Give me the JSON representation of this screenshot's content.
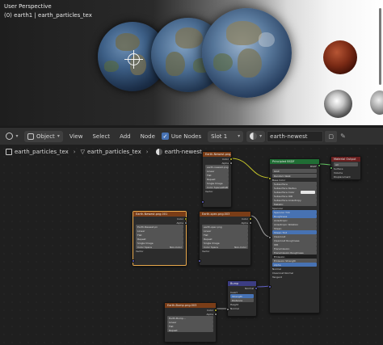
{
  "viewport": {
    "perspective_label": "User Perspective",
    "object_label": "(0) earth1 | earth_particles_tex"
  },
  "header": {
    "object_mode": "Object",
    "menus": [
      "View",
      "Select",
      "Add",
      "Node"
    ],
    "use_nodes_label": "Use Nodes",
    "use_nodes_checked": true,
    "slot": "Slot 1",
    "material": "earth-newest"
  },
  "breadcrumb": {
    "object": "earth_particles_tex",
    "mesh": "earth_particles_tex",
    "material": "earth-newest"
  },
  "nodes": {
    "img_top": {
      "title": "Earth-Newest.png.003",
      "outputs": [
        "Color",
        "Alpha"
      ],
      "file": "earth-newest.png",
      "fields": [
        "Linear",
        "Flat",
        "Repeat",
        "Single Image",
        "Color Space",
        "sRGB"
      ],
      "input": "Vector"
    },
    "img_left": {
      "title": "Earth-Newest.png.001",
      "outputs": [
        "Color",
        "Alpha"
      ],
      "file": "Earth-Newest.pn",
      "fields": [
        "Linear",
        "Flat",
        "Repeat",
        "Single Image",
        "Color Space",
        "Non-Color"
      ],
      "input": "Vector"
    },
    "img_mid": {
      "title": "Earth-spec.png.003",
      "outputs": [
        "Color",
        "Alpha"
      ],
      "file": "earth-spec.png",
      "fields": [
        "Linear",
        "Flat",
        "Repeat",
        "Single Image",
        "Color Space",
        "Non-Color"
      ],
      "input": "Vector"
    },
    "img_bottom": {
      "title": "Earth-Bump.png.003",
      "outputs": [
        "Color",
        "Alpha"
      ],
      "file": "Earth-Bump...",
      "fields": [
        "Linear",
        "Flat",
        "Repeat"
      ],
      "input": "Vector"
    },
    "bsdf": {
      "title": "Principled BSDF",
      "output": "BSDF",
      "dropdowns": [
        "GGX",
        "Random Walk"
      ],
      "rows": [
        "Base Color",
        "Subsurface",
        "Subsurface Radius",
        "Subsurface Color",
        "Subsurface IOR",
        "Subsurface Anisotropy",
        "Metallic",
        "Specular",
        "Specular Tint",
        "Roughness",
        "Anisotropic",
        "Anisotropic Rotation",
        "Sheen",
        "Sheen Tint",
        "Clearcoat",
        "Clearcoat Roughness",
        "IOR",
        "Transmission",
        "Transmission Roughness",
        "Emission",
        "Emission Strength",
        "Alpha",
        "Normal",
        "Clearcoat Normal",
        "Tangent"
      ]
    },
    "output": {
      "title": "Material Output",
      "dropdown": "All",
      "inputs": [
        "Surface",
        "Volume",
        "Displacement"
      ]
    },
    "bump": {
      "title": "Bump",
      "output": "Normal",
      "invert": "Invert",
      "fields": [
        "Strength",
        "Distance"
      ],
      "inputs": [
        "Height",
        "Normal"
      ]
    }
  },
  "colors": {
    "texture_header": "#7a3d17",
    "shader_header": "#206d34",
    "output_header": "#6b2020",
    "vector_header": "#3c3d83",
    "selection": "#e8a84c",
    "accent": "#4772b3"
  }
}
